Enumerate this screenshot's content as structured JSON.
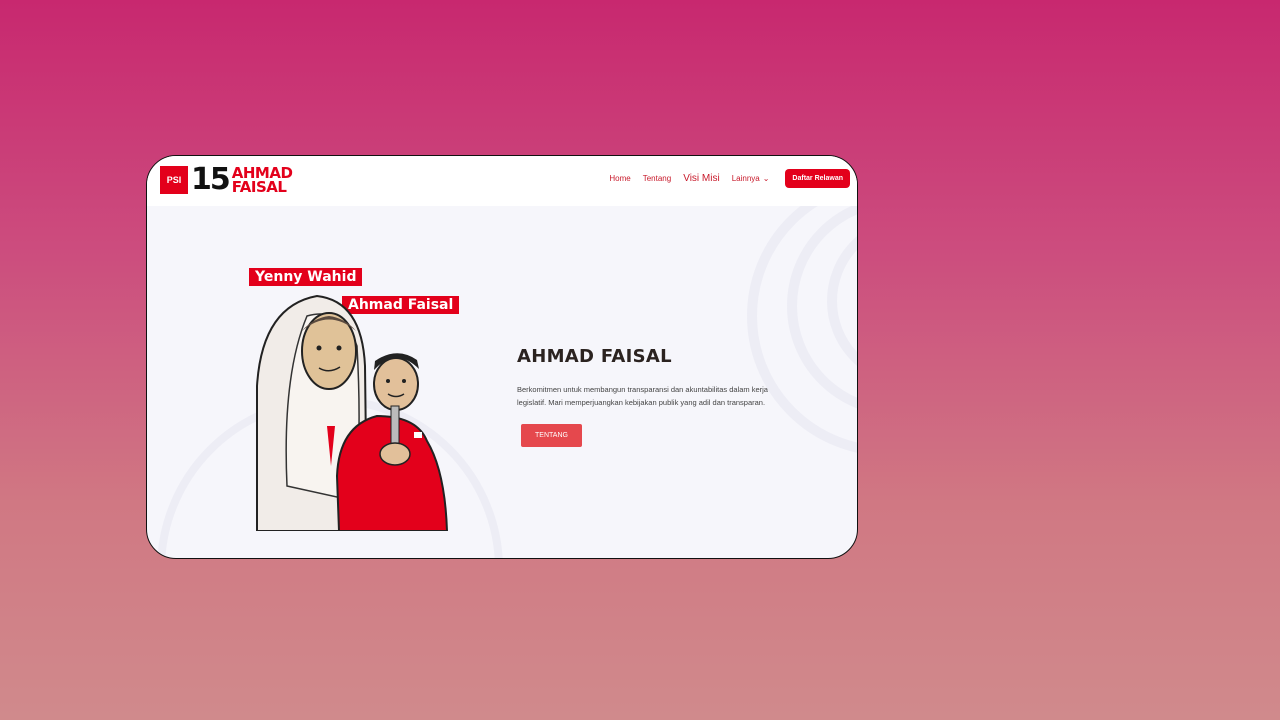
{
  "header": {
    "logo": {
      "party": "PSI",
      "number": "15",
      "name_line1": "AHMAD",
      "name_line2": "FAISAL"
    },
    "nav": [
      {
        "label": "Home"
      },
      {
        "label": "Tentang"
      },
      {
        "label": "Visi Misi"
      },
      {
        "label": "Lainnya"
      }
    ],
    "cta_label": "Daftar Relawan"
  },
  "hero": {
    "image_labels": [
      "Yenny Wahid",
      "Ahmad Faisal"
    ],
    "title": "AHMAD FAISAL",
    "description": "Berkomitmen untuk membangun transparansi dan akuntabilitas dalam kerja legislatif. Mari memperjuangkan kebijakan publik yang adil dan transparan.",
    "button_label": "TENTANG"
  },
  "colors": {
    "accent": "#e3001b",
    "button": "#e5484d",
    "background_top": "#c8286f",
    "background_bottom": "#d08a8c"
  }
}
